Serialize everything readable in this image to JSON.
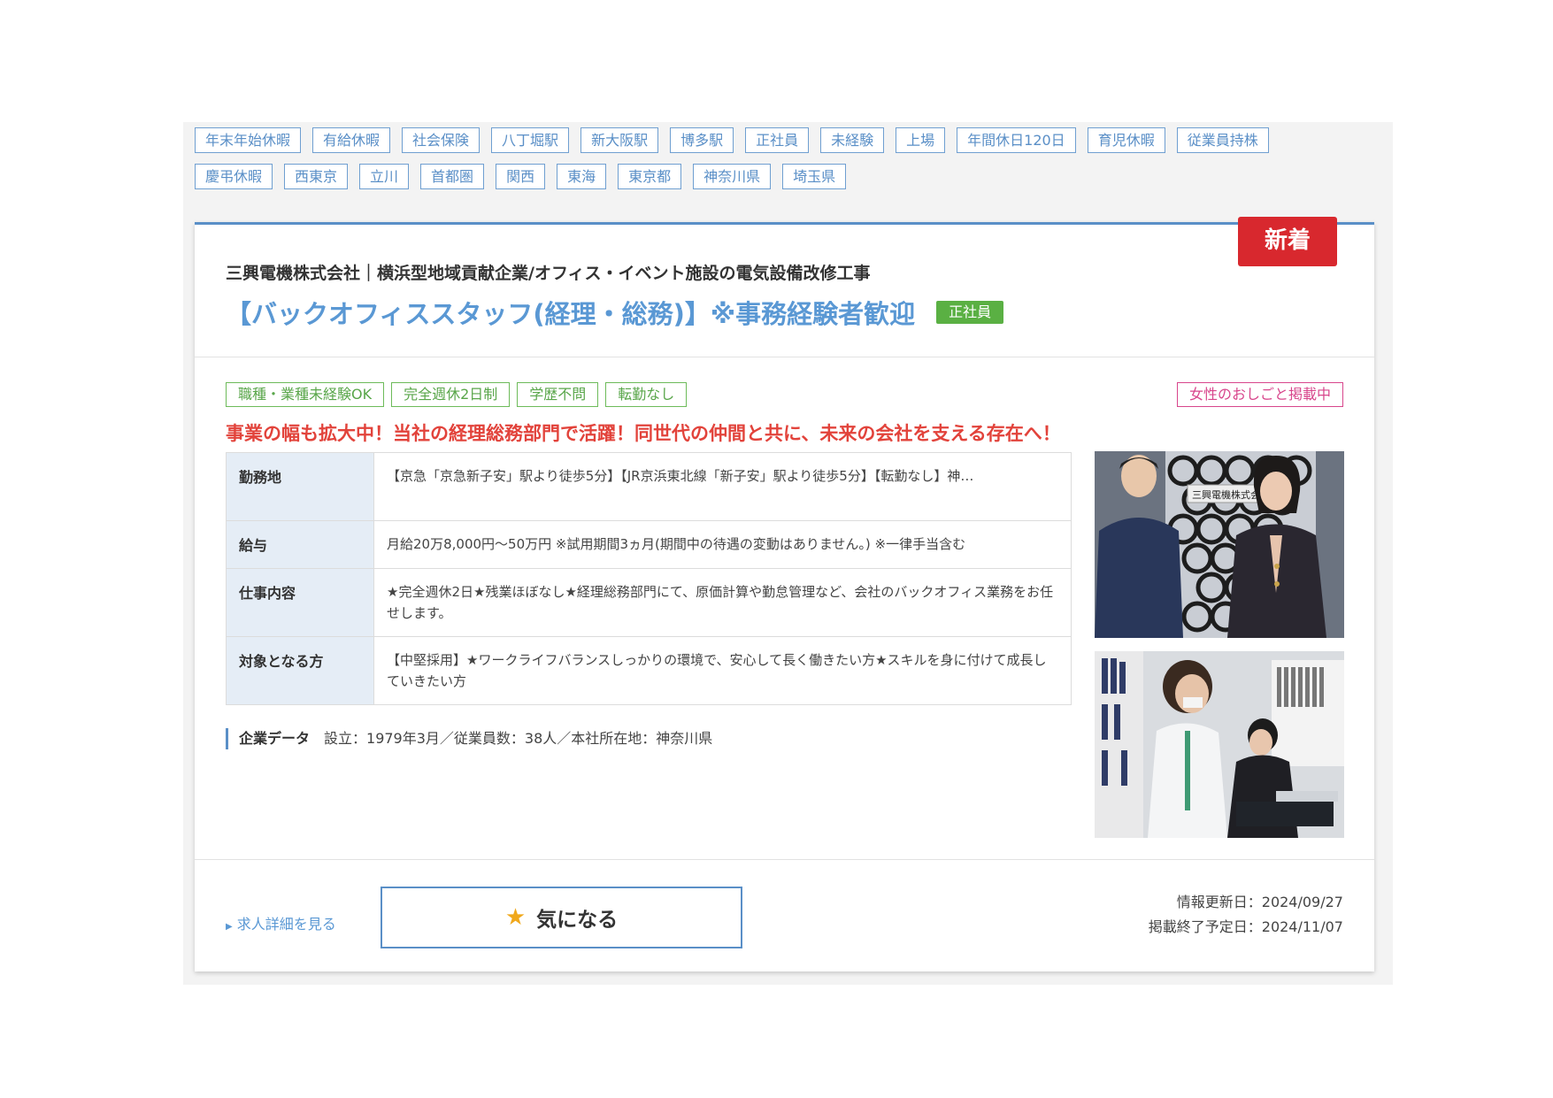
{
  "tags": {
    "row1": [
      "年末年始休暇",
      "有給休暇",
      "社会保険",
      "八丁堀駅",
      "新大阪駅",
      "博多駅",
      "正社員",
      "未経験",
      "上場",
      "年間休日120日",
      "育児休暇",
      "従業員持株"
    ],
    "row2": [
      "慶弔休暇",
      "西東京",
      "立川",
      "首都圏",
      "関西",
      "東海",
      "東京都",
      "神奈川県",
      "埼玉県"
    ]
  },
  "card": {
    "new_badge": "新着",
    "company": "三興電機株式会社｜横浜型地域貢献企業/オフィス・イベント施設の電気設備改修工事",
    "job_title": "【バックオフィススタッフ(経理・総務)】※事務経験者歓迎",
    "employment_badge": "正社員",
    "features": [
      "職種・業種未経験OK",
      "完全週休2日制",
      "学歴不問",
      "転勤なし"
    ],
    "women_badge": "女性のおしごと掲載中",
    "catchcopy": "事業の幅も拡大中！当社の経理総務部門で活躍！同世代の仲間と共に、未来の会社を支える存在へ！",
    "info": [
      {
        "label": "勤務地",
        "value": "【京急「京急新子安」駅より徒歩5分】【JR京浜東北線「新子安」駅より徒歩5分】【転勤なし】神…"
      },
      {
        "label": "給与",
        "value": "月給20万8,000円～50万円 ※試用期間3ヵ月(期間中の待遇の変動はありません。) ※一律手当含む"
      },
      {
        "label": "仕事内容",
        "value": "★完全週休2日★残業ほぼなし★経理総務部門にて、原価計算や勤怠管理など、会社のバックオフィス業務をお任せします。"
      },
      {
        "label": "対象となる方",
        "value": "【中堅採用】★ワークライフバランスしっかりの環境で、安心して長く働きたい方★スキルを身に付けて成長していきたい方"
      }
    ],
    "company_data": {
      "label": "企業データ",
      "value": "設立：1979年3月／従業員数：38人／本社所在地：神奈川県"
    },
    "photo1_sign": "三興電機株式会社",
    "detail_link": "求人詳細を見る",
    "favorite_label": "気になる",
    "updated": "情報更新日：2024/09/27",
    "end_date": "掲載終了予定日：2024/11/07"
  },
  "colors": {
    "accent": "#5a8fc7",
    "new_badge": "#d8282e",
    "catch": "#e2433b",
    "feature": "#59a64a",
    "women": "#d8468c"
  }
}
